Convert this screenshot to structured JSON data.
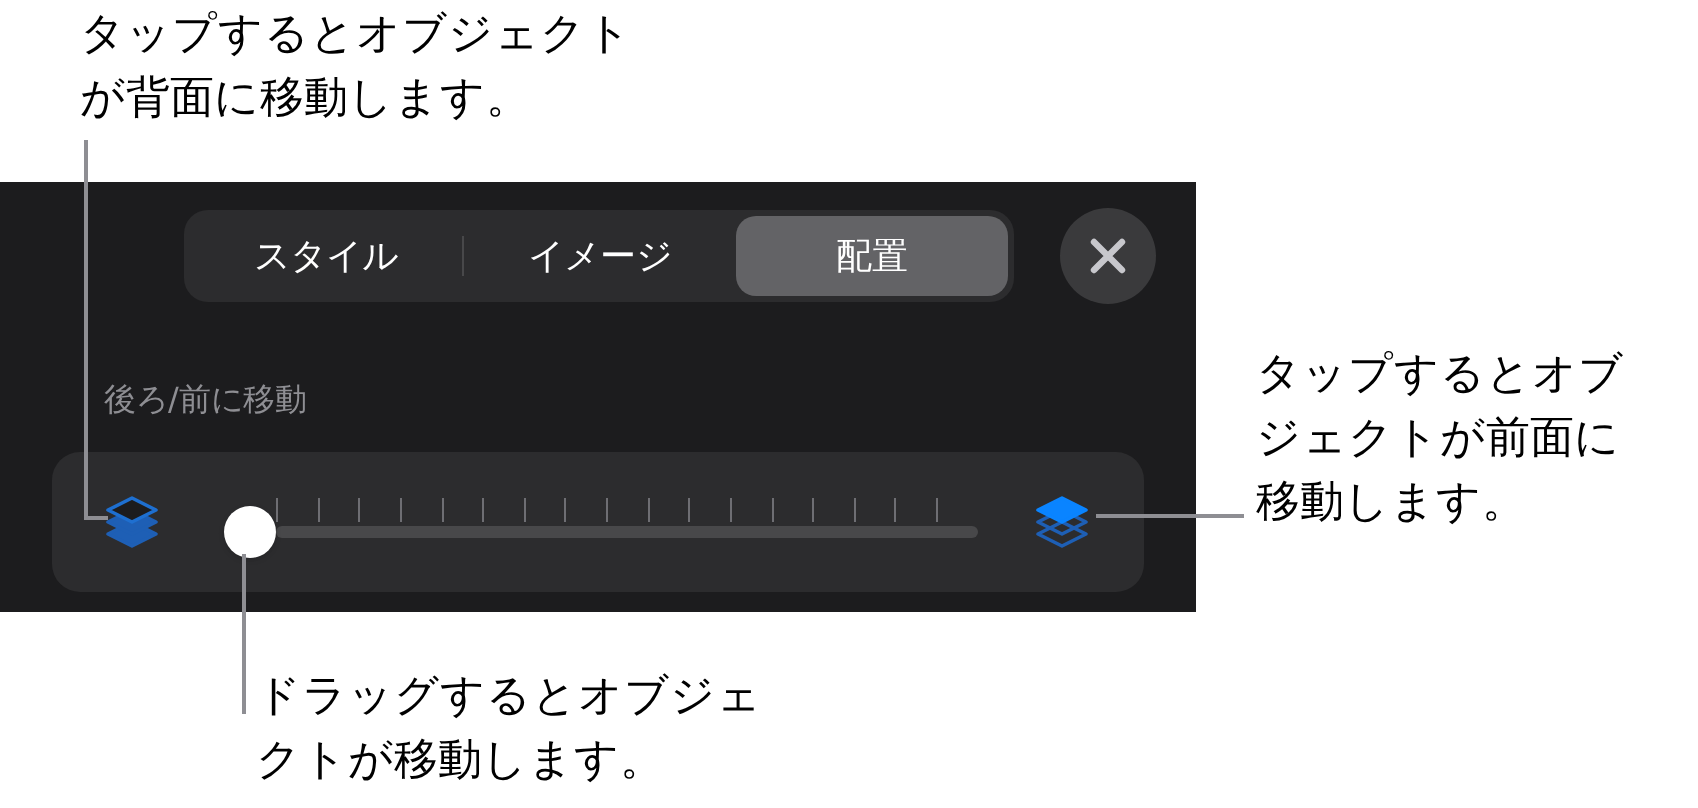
{
  "callouts": {
    "back": [
      "タップするとオブジェクト",
      "が背面に移動します。"
    ],
    "front": [
      "タップするとオブ",
      "ジェクトが前面に",
      "移動します。"
    ],
    "drag": [
      "ドラッグするとオブジェ",
      "クトが移動します。"
    ]
  },
  "tabs": [
    {
      "label": "スタイル",
      "selected": false
    },
    {
      "label": "イメージ",
      "selected": false
    },
    {
      "label": "配置",
      "selected": true
    }
  ],
  "slider": {
    "label": "後ろ/前に移動",
    "level": 0
  }
}
